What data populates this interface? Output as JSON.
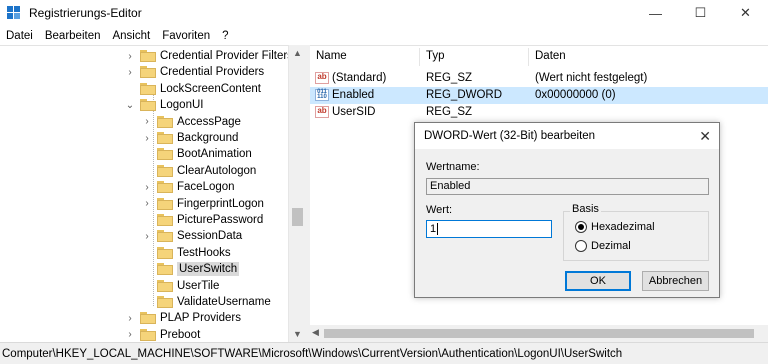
{
  "window": {
    "title": "Registrierungs-Editor",
    "minimize_glyph": "—",
    "maximize_glyph": "☐",
    "close_glyph": "✕"
  },
  "menu": [
    "Datei",
    "Bearbeiten",
    "Ansicht",
    "Favoriten",
    "?"
  ],
  "tree": {
    "items": [
      {
        "label": "Credential Provider Filters",
        "expanded": false,
        "has_children": true
      },
      {
        "label": "Credential Providers",
        "expanded": false,
        "has_children": true
      },
      {
        "label": "LockScreenContent",
        "expanded": false,
        "has_children": false
      },
      {
        "label": "LogonUI",
        "expanded": true,
        "has_children": true
      },
      {
        "label": "AccessPage",
        "expanded": false,
        "has_children": true
      },
      {
        "label": "Background",
        "expanded": false,
        "has_children": true
      },
      {
        "label": "BootAnimation",
        "expanded": false,
        "has_children": false
      },
      {
        "label": "ClearAutologon",
        "expanded": false,
        "has_children": false
      },
      {
        "label": "FaceLogon",
        "expanded": false,
        "has_children": true
      },
      {
        "label": "FingerprintLogon",
        "expanded": false,
        "has_children": true
      },
      {
        "label": "PicturePassword",
        "expanded": false,
        "has_children": false
      },
      {
        "label": "SessionData",
        "expanded": false,
        "has_children": true
      },
      {
        "label": "TestHooks",
        "expanded": false,
        "has_children": false
      },
      {
        "label": "UserSwitch",
        "expanded": false,
        "has_children": false,
        "selected": true
      },
      {
        "label": "UserTile",
        "expanded": false,
        "has_children": false
      },
      {
        "label": "ValidateUsername",
        "expanded": false,
        "has_children": false
      },
      {
        "label": "PLAP Providers",
        "expanded": false,
        "has_children": true
      },
      {
        "label": "Preboot",
        "expanded": false,
        "has_children": true
      }
    ]
  },
  "values": {
    "headers": {
      "name": "Name",
      "type": "Typ",
      "data": "Daten"
    },
    "rows": [
      {
        "icon": "ab",
        "name": "(Standard)",
        "type": "REG_SZ",
        "data": "(Wert nicht festgelegt)"
      },
      {
        "icon": "dword",
        "name": "Enabled",
        "type": "REG_DWORD",
        "data": "0x00000000 (0)",
        "selected": true
      },
      {
        "icon": "ab",
        "name": "UserSID",
        "type": "REG_SZ",
        "data": ""
      }
    ]
  },
  "statusbar": {
    "path": "Computer\\HKEY_LOCAL_MACHINE\\SOFTWARE\\Microsoft\\Windows\\CurrentVersion\\Authentication\\LogonUI\\UserSwitch"
  },
  "dialog": {
    "title": "DWORD-Wert (32-Bit) bearbeiten",
    "name_label": "Wertname:",
    "name_value": "Enabled",
    "value_label": "Wert:",
    "value_input": "1",
    "base_label": "Basis",
    "radio_hex": "Hexadezimal",
    "radio_dec": "Dezimal",
    "selected_base": "hex",
    "ok_label": "OK",
    "cancel_label": "Abbrechen",
    "close_glyph": "✕"
  },
  "colors": {
    "accent": "#0078d7",
    "selection": "#cce8ff",
    "folder": "#f5d47a"
  }
}
